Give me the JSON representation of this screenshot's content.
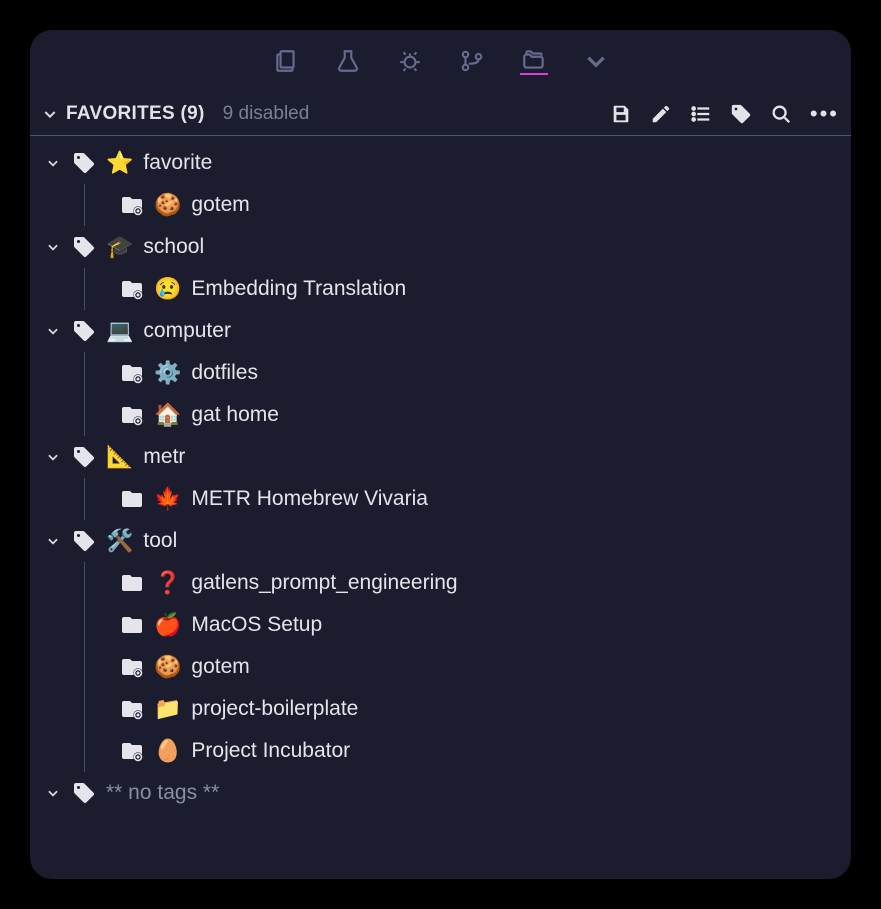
{
  "toolbar": {
    "tabs": [
      "explorer",
      "science",
      "debug",
      "git",
      "folders",
      "collapse"
    ],
    "active_tab": "folders"
  },
  "header": {
    "title": "FAVORITES (9)",
    "subtitle": "9 disabled"
  },
  "tree": [
    {
      "type": "tag",
      "expanded": true,
      "emoji": "⭐",
      "label": "favorite",
      "children": [
        {
          "type": "project",
          "folder_variant": "dot",
          "emoji": "🍪",
          "label": "gotem"
        }
      ]
    },
    {
      "type": "tag",
      "expanded": true,
      "emoji": "🎓",
      "label": "school",
      "children": [
        {
          "type": "project",
          "folder_variant": "dot",
          "emoji": "😢",
          "label": "Embedding Translation"
        }
      ]
    },
    {
      "type": "tag",
      "expanded": true,
      "emoji": "💻",
      "label": "computer",
      "children": [
        {
          "type": "project",
          "folder_variant": "dot",
          "emoji": "⚙️",
          "label": "dotfiles"
        },
        {
          "type": "project",
          "folder_variant": "dot",
          "emoji": "🏠",
          "label": "gat home"
        }
      ]
    },
    {
      "type": "tag",
      "expanded": true,
      "emoji": "📐",
      "label": "metr",
      "children": [
        {
          "type": "project",
          "folder_variant": "plain",
          "emoji": "🍁",
          "label": "METR Homebrew Vivaria"
        }
      ]
    },
    {
      "type": "tag",
      "expanded": true,
      "emoji": "🛠️",
      "label": "tool",
      "children": [
        {
          "type": "project",
          "folder_variant": "plain",
          "emoji": "❓",
          "label": "gatlens_prompt_engineering"
        },
        {
          "type": "project",
          "folder_variant": "plain",
          "emoji": "🍎",
          "label": "MacOS Setup"
        },
        {
          "type": "project",
          "folder_variant": "dot",
          "emoji": "🍪",
          "label": "gotem"
        },
        {
          "type": "project",
          "folder_variant": "dot",
          "emoji": "📁",
          "label": "project-boilerplate"
        },
        {
          "type": "project",
          "folder_variant": "dot",
          "emoji": "🥚",
          "label": "Project Incubator"
        }
      ]
    },
    {
      "type": "tag",
      "expanded": false,
      "emoji": "",
      "label": "** no tags **",
      "notags": true,
      "children": []
    }
  ]
}
